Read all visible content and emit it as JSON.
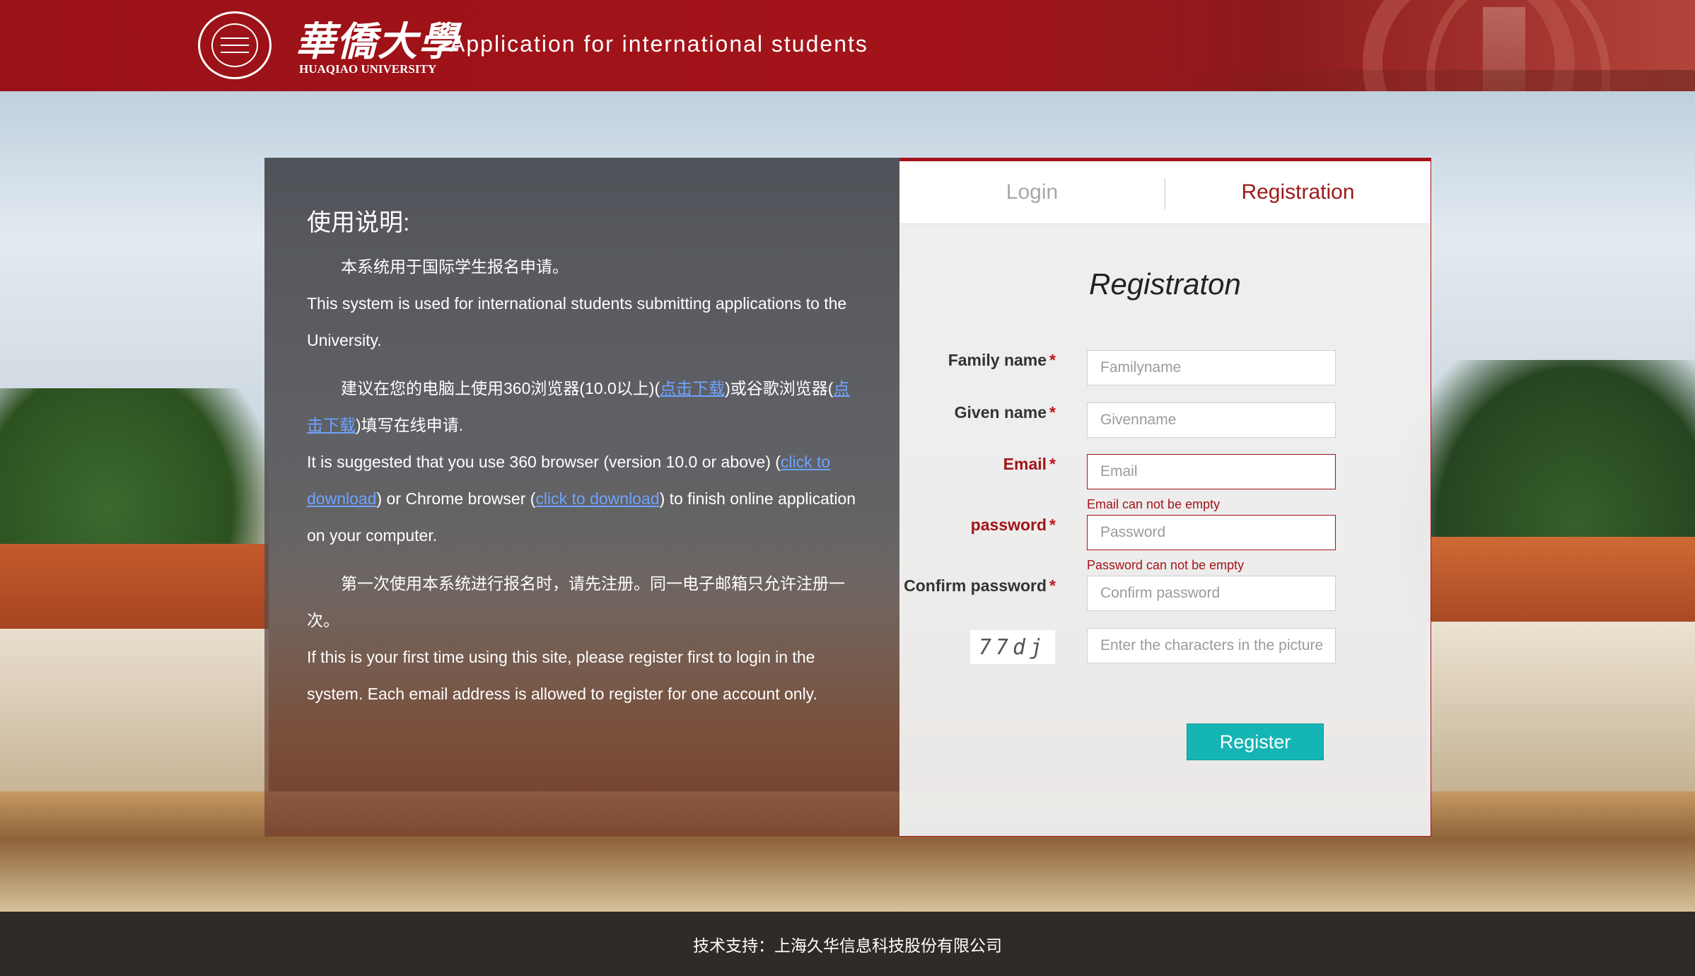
{
  "header": {
    "logo_cn": "華僑大學",
    "logo_en": "HUAQIAO UNIVERSITY",
    "title": "Application for international students"
  },
  "instructions": {
    "title": "使用说明:",
    "p1_cn": "本系统用于国际学生报名申请。",
    "p1_en": "This system is used for international students submitting applications to the University.",
    "p2_cn_a": "建议在您的电脑上使用360浏览器(10.0以上)(",
    "p2_cn_link1": "点击下载",
    "p2_cn_b": ")或谷歌浏览器(",
    "p2_cn_link2": "点击下载",
    "p2_cn_c": ")填写在线申请.",
    "p2_en_a": "It is suggested that you use 360 browser (version 10.0 or above) (",
    "p2_en_link1": "click to download",
    "p2_en_b": ") or Chrome browser (",
    "p2_en_link2": "click to download",
    "p2_en_c": ") to finish online application on your computer.",
    "p3_cn": "第一次使用本系统进行报名时，请先注册。同一电子邮箱只允许注册一次。",
    "p3_en": "If this is your first time using this site, please register first to login in the system. Each email address is allowed to register for one account only."
  },
  "tabs": {
    "login": "Login",
    "registration": "Registration"
  },
  "form": {
    "title": "Registraton",
    "family_name_label": "Family name",
    "family_name_placeholder": "Familyname",
    "given_name_label": "Given name",
    "given_name_placeholder": "Givenname",
    "email_label": "Email",
    "email_placeholder": "Email",
    "email_error": "Email can not be empty",
    "password_label": "password",
    "password_placeholder": "Password",
    "password_error": "Password can not be empty",
    "confirm_label": "Confirm password",
    "confirm_placeholder": "Confirm password",
    "captcha_text": "77dj",
    "captcha_placeholder": "Enter the characters in the picture",
    "required_mark": "*",
    "register_button": "Register"
  },
  "footer": {
    "text": "技术支持：上海久华信息科技股份有限公司"
  },
  "colors": {
    "brand_red": "#a3141a",
    "button_teal": "#16b5b5",
    "link_blue": "#6fa3ff"
  }
}
